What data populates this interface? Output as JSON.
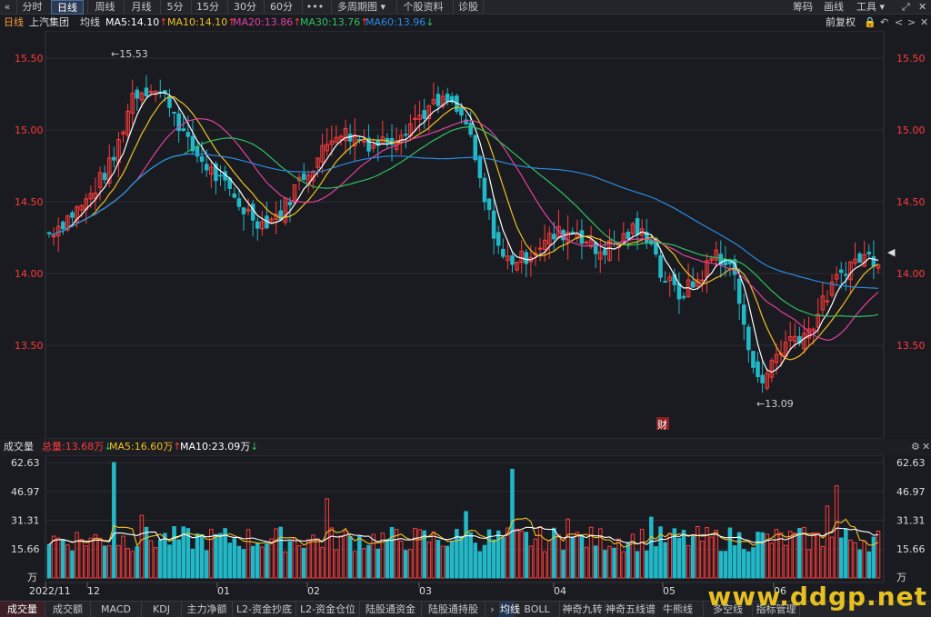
{
  "toolbar": {
    "back_icon": "double-chevron-left-icon",
    "tabs": [
      "分时",
      "日线",
      "周线",
      "月线",
      "5分",
      "15分",
      "30分",
      "60分"
    ],
    "active_tab": "日线",
    "more_label": "•••",
    "multi_period": "多周期图",
    "stock_info": "个股资料",
    "diagnose": "诊股",
    "right": {
      "chips": "筹码",
      "draw": "画线",
      "tools": "工具"
    }
  },
  "info": {
    "period": "日线",
    "stock": "上汽集团",
    "ma_label": "均线",
    "ma5": "MA5:14.10",
    "ma10": "MA10:14.10",
    "ma20": "MA20:13.86",
    "ma30": "MA30:13.76",
    "ma60": "MA60:13.96",
    "adjust": "前复权",
    "colors": {
      "ma5": "#ffffff",
      "ma10": "#f0c020",
      "ma20": "#e040a0",
      "ma30": "#30c060",
      "ma60": "#2a8ae0",
      "up": "#ff3b3b",
      "down": "#22b8c8"
    }
  },
  "price_axis": {
    "ticks": [
      "15.50",
      "15.00",
      "14.50",
      "14.00",
      "13.50"
    ]
  },
  "x_axis": {
    "labels": [
      "2022/11",
      "12",
      "01",
      "02",
      "03",
      "04",
      "05",
      "06"
    ]
  },
  "annotations": {
    "high": "15.53",
    "low": "13.09",
    "badge": "财"
  },
  "volume": {
    "title": "成交量",
    "total": "总量:13.68万",
    "ma5": "MA5:16.60万",
    "ma10": "MA10:23.09万",
    "ticks": [
      "62.63",
      "46.97",
      "31.31",
      "15.66",
      "万"
    ]
  },
  "bottom_tabs": [
    "成交量",
    "成交额",
    "MACD",
    "KDJ",
    "主力净额",
    "L2-资金抄底",
    "L2-资金仓位",
    "陆股通资金",
    "陆股通持股",
    "均线",
    "BOLL",
    "神奇九转",
    "神奇五线谱",
    "牛熊线",
    "多空线",
    "指标管理"
  ],
  "watermark": "www.ddgp.net",
  "chart_data": {
    "type": "candlestick",
    "price_range": [
      13.0,
      15.7
    ],
    "high": 15.53,
    "low": 13.09,
    "ma_latest": {
      "ma5": 14.1,
      "ma10": 14.1,
      "ma20": 13.86,
      "ma30": 13.76,
      "ma60": 13.96
    },
    "volume_range": [
      0,
      62.63
    ],
    "volume_unit": "万",
    "vol_ma_latest": {
      "ma5": 16.6,
      "ma10": 23.09
    },
    "vol_latest": 13.68
  }
}
